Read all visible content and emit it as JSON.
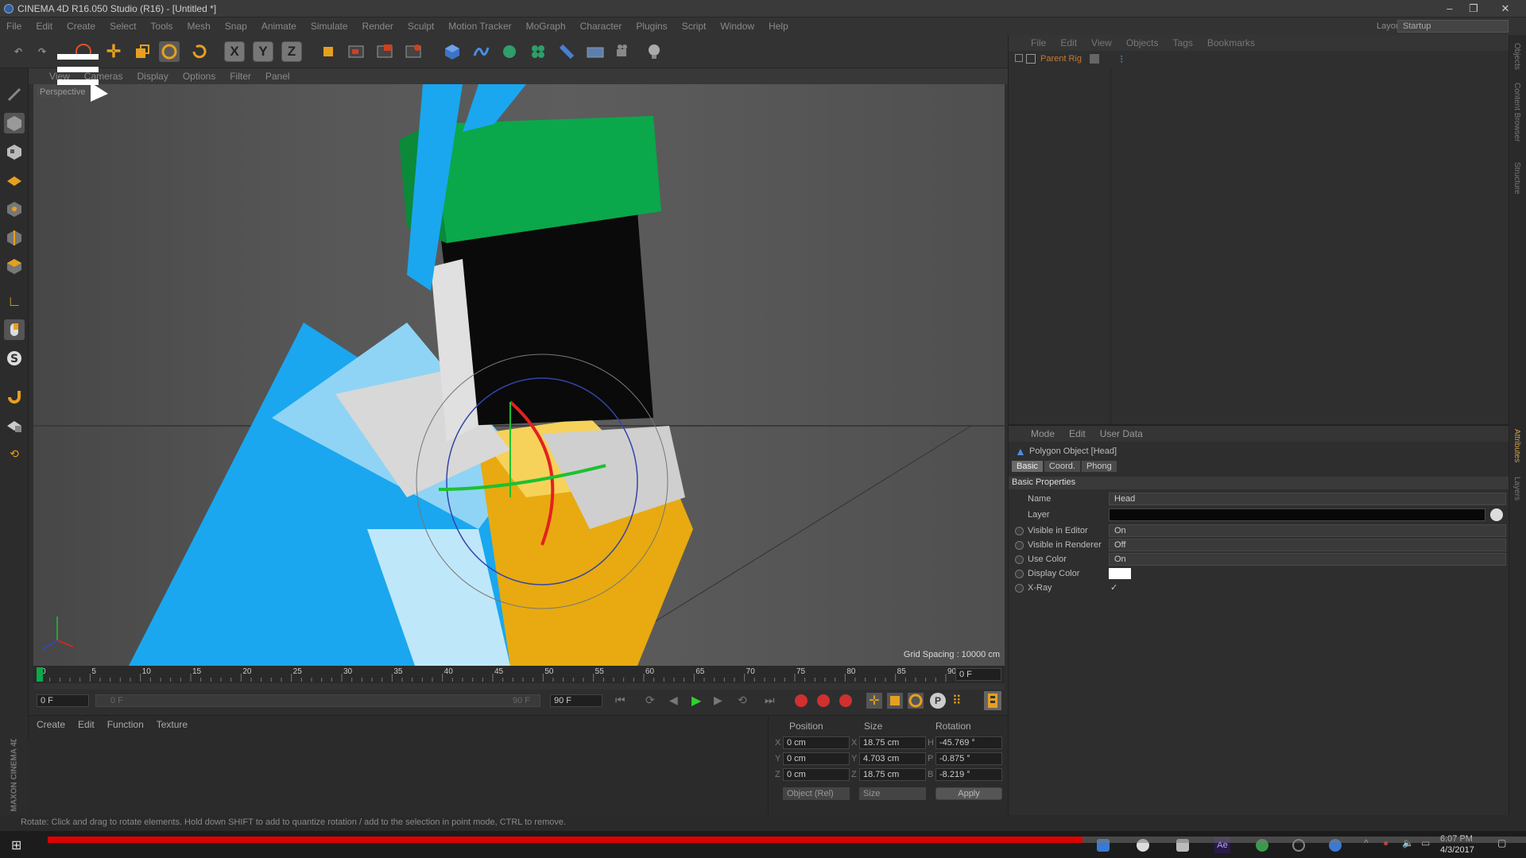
{
  "window": {
    "title": "CINEMA 4D R16.050 Studio (R16) - [Untitled *]",
    "controls": [
      "–",
      "❐",
      "✕"
    ]
  },
  "menubar": [
    "File",
    "Edit",
    "Create",
    "Select",
    "Tools",
    "Mesh",
    "Snap",
    "Animate",
    "Simulate",
    "Render",
    "Sculpt",
    "Motion Tracker",
    "MoGraph",
    "Character",
    "Plugins",
    "Script",
    "Window",
    "Help"
  ],
  "layout": {
    "label": "Layout:",
    "value": "Startup"
  },
  "toolbar": {
    "axes": [
      "X",
      "Y",
      "Z"
    ]
  },
  "viewport": {
    "menu": [
      "View",
      "Cameras",
      "Display",
      "Options",
      "Filter",
      "Panel"
    ],
    "camera_label": "Perspective",
    "grid_spacing": "Grid Spacing : 10000 cm"
  },
  "timeline": {
    "ticks": [
      "0",
      "5",
      "10",
      "15",
      "20",
      "25",
      "30",
      "35",
      "40",
      "45",
      "50",
      "55",
      "60",
      "65",
      "70",
      "75",
      "80",
      "85",
      "90"
    ],
    "current_frame": "0 F"
  },
  "playback": {
    "start": "0 F",
    "range_start": "0 F",
    "range_end": "90 F",
    "end": "90 F"
  },
  "material_panel": {
    "menu": [
      "Create",
      "Edit",
      "Function",
      "Texture"
    ],
    "brand": "MAXON CINEMA 4D"
  },
  "coordinates": {
    "headers": [
      "Position",
      "Size",
      "Rotation"
    ],
    "rows": [
      {
        "axis": "X",
        "pos": "0 cm",
        "size_axis": "X",
        "size": "18.75 cm",
        "rot_axis": "H",
        "rot": "-45.769 °"
      },
      {
        "axis": "Y",
        "pos": "0 cm",
        "size_axis": "Y",
        "size": "4.703 cm",
        "rot_axis": "P",
        "rot": "-0.875 °"
      },
      {
        "axis": "Z",
        "pos": "0 cm",
        "size_axis": "Z",
        "size": "18.75 cm",
        "rot_axis": "B",
        "rot": "-8.219 °"
      }
    ],
    "mode_select": "Object (Rel)",
    "size_select": "Size",
    "apply": "Apply"
  },
  "object_manager": {
    "menu": [
      "File",
      "Edit",
      "View",
      "Objects",
      "Tags",
      "Bookmarks"
    ],
    "item": "Parent Rig"
  },
  "attributes": {
    "menu": [
      "Mode",
      "Edit",
      "User Data"
    ],
    "object_title": "Polygon Object [Head]",
    "tabs": [
      "Basic",
      "Coord.",
      "Phong"
    ],
    "section": "Basic Properties",
    "name_label": "Name",
    "name_value": "Head",
    "layer_label": "Layer",
    "visible_editor_label": "Visible in Editor",
    "visible_editor_value": "On",
    "visible_renderer_label": "Visible in Renderer",
    "visible_renderer_value": "Off",
    "use_color_label": "Use Color",
    "use_color_value": "On",
    "display_color_label": "Display Color",
    "xray_label": "X-Ray",
    "xray_value": "✓"
  },
  "right_strip": [
    "Objects",
    "Content Browser",
    "Structure",
    "Attributes",
    "Layers"
  ],
  "status": "Rotate: Click and drag to rotate elements. Hold down SHIFT to add to quantize rotation / add to the selection in point mode, CTRL to remove.",
  "taskbar": {
    "time": "6:07 PM",
    "date": "4/3/2017"
  },
  "video_progress": 0.7,
  "colors": {
    "accent_green": "#0aa84a",
    "progress_red": "#e00000",
    "cube_blue": "#3b74c7"
  }
}
